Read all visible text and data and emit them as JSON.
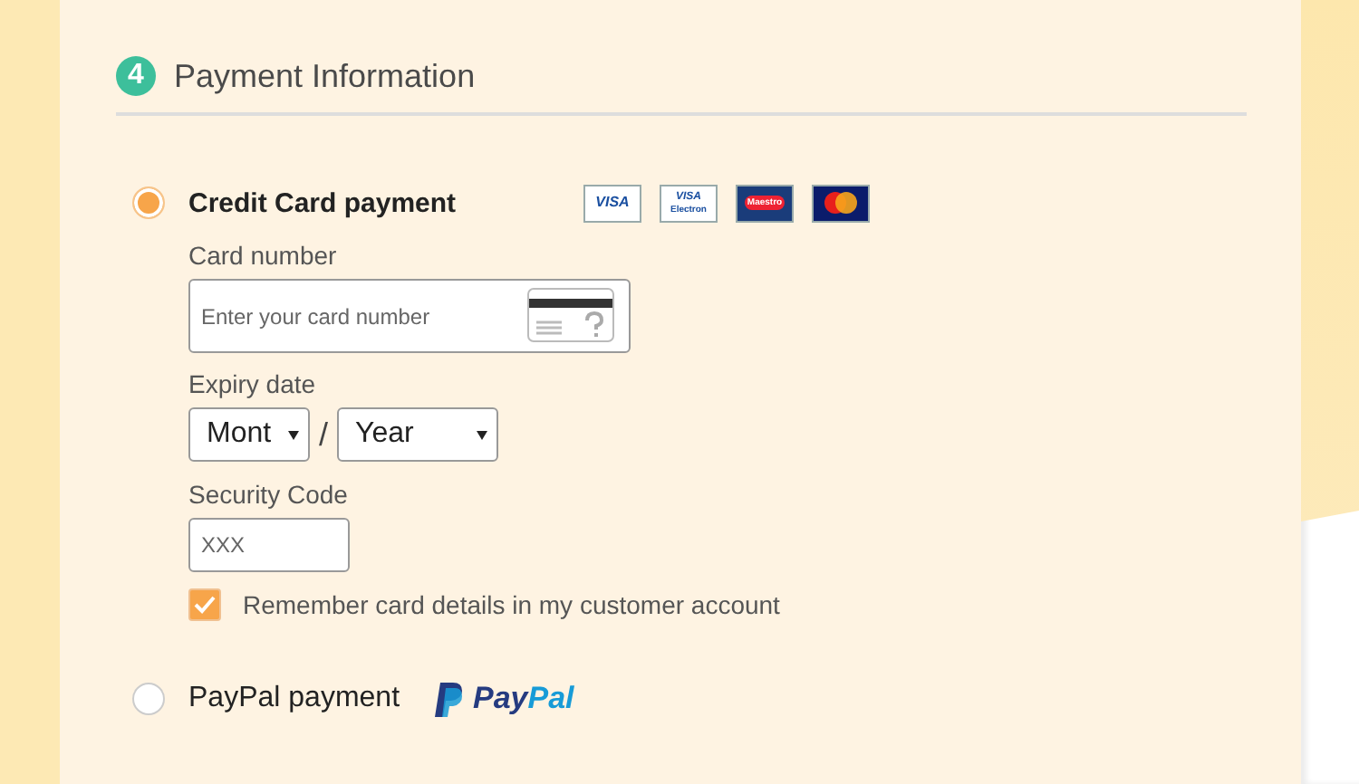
{
  "step": {
    "number": "4",
    "title": "Payment Information"
  },
  "methods": [
    {
      "kind": "card",
      "label": "Credit Card payment",
      "selected": true,
      "logos": [
        {
          "kind": "visa",
          "label": "VISA"
        },
        {
          "kind": "visa-electron",
          "label": "VISA",
          "sub": "Electron"
        },
        {
          "kind": "maestro",
          "label": "Maestro"
        },
        {
          "kind": "mastercard"
        }
      ]
    },
    {
      "kind": "paypal",
      "label": "PayPal payment",
      "selected": false,
      "brand_parts": [
        "Pay",
        "Pal"
      ]
    }
  ],
  "card_form": {
    "card_number": {
      "label": "Card number",
      "placeholder": "Enter your card number"
    },
    "expiry": {
      "label": "Expiry date",
      "month": "Mont",
      "separator": "/",
      "year": "Year"
    },
    "security": {
      "label": "Security Code",
      "placeholder": "XXX"
    },
    "remember": {
      "label": "Remember card details in my customer account",
      "checked": true
    }
  }
}
